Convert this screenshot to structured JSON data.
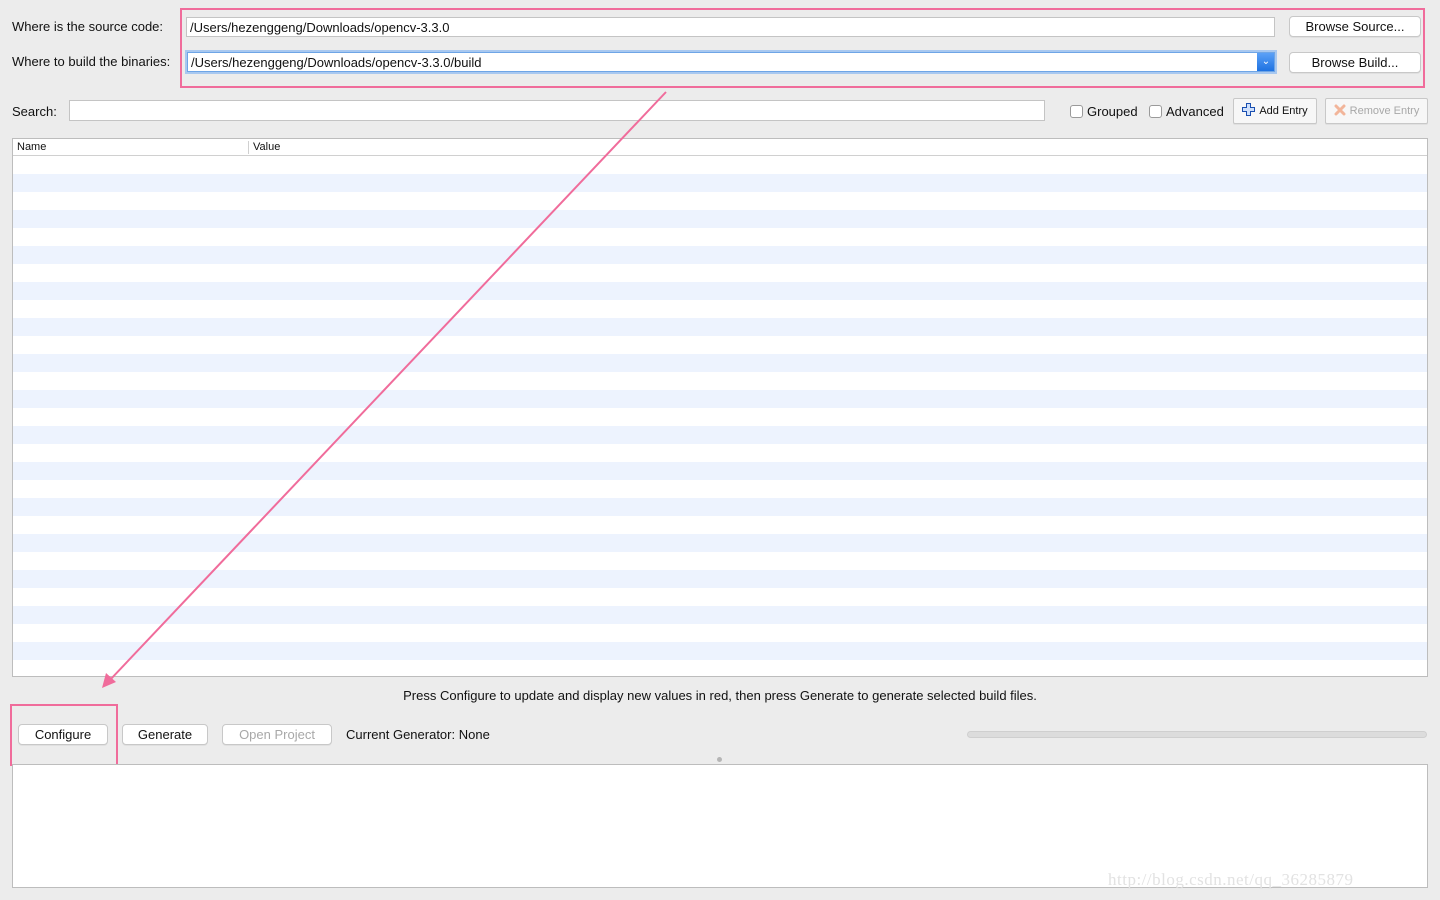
{
  "source": {
    "label": "Where is the source code:",
    "path": "/Users/hezenggeng/Downloads/opencv-3.3.0",
    "browse_label": "Browse Source..."
  },
  "build": {
    "label": "Where to build the binaries:",
    "path": "/Users/hezenggeng/Downloads/opencv-3.3.0/build",
    "browse_label": "Browse Build..."
  },
  "search": {
    "label": "Search:",
    "value": ""
  },
  "options": {
    "grouped_label": "Grouped",
    "grouped_checked": false,
    "advanced_label": "Advanced",
    "advanced_checked": false,
    "add_entry_label": "Add Entry",
    "remove_entry_label": "Remove Entry"
  },
  "table": {
    "columns": [
      "Name",
      "Value"
    ]
  },
  "hint_text": "Press Configure to update and display new values in red, then press Generate to generate selected build files.",
  "actions": {
    "configure_label": "Configure",
    "generate_label": "Generate",
    "open_project_label": "Open Project",
    "current_generator": "Current Generator: None"
  },
  "watermark": "http://blog.csdn.net/qq_36285879",
  "colors": {
    "annotation": "#f06c9b",
    "row_stripe": "#edf3fe",
    "accent": "#1a6fe0"
  }
}
